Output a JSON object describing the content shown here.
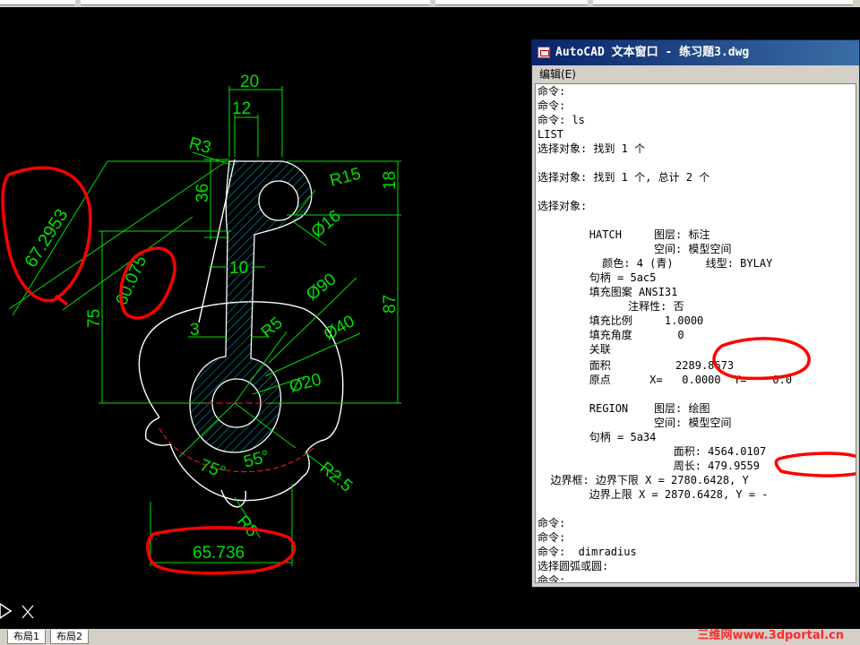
{
  "window": {
    "title": "AutoCAD 文本窗口 - 练习题3.dwg",
    "menu": "编辑(E)"
  },
  "drawing": {
    "dims": {
      "d20": "20",
      "d12": "12",
      "r3": "R3",
      "d36": "36",
      "r15": "R15",
      "d18": "18",
      "phi16": "Ø16",
      "d10": "10",
      "phi90": "Ø90",
      "d87": "87",
      "d75": "75",
      "d3": "3",
      "r5a": "R5",
      "phi40": "Ø40",
      "phi20": "Ø20",
      "a75": "75°",
      "a55": "55°",
      "r25": "R2.5",
      "r5b": "R5"
    },
    "annotations": {
      "a1": "67.2953",
      "a2": "60.075",
      "a3": "65.736"
    }
  },
  "text_lines": [
    "命令:",
    "命令:",
    "命令: ls",
    "LIST",
    "选择对象: 找到 1 个",
    "",
    "选择对象: 找到 1 个, 总计 2 个",
    "",
    "选择对象:",
    "",
    "        HATCH     图层: 标注",
    "                  空间: 模型空间",
    "          颜色: 4 (青)     线型: BYLAY",
    "        句柄 = 5ac5",
    "        填充图案 ANSI31",
    "              注释性: 否",
    "        填充比例     1.0000",
    "        填充角度       0",
    "        关联",
    "        面积          2289.8673",
    "        原点      X=   0.0000  Y=    0.0",
    "",
    "        REGION    图层: 绘图",
    "                  空间: 模型空间",
    "        句柄 = 5a34",
    "                     面积: 4564.0107",
    "                     周长: 479.9559",
    "  边界框: 边界下限 X = 2780.6428, Y",
    "        边界上限 X = 2870.6428, Y = -",
    "",
    "",
    "命令:",
    "命令:",
    "命令:  dimradius",
    "选择圆弧或圆:",
    "命令:"
  ],
  "tabs": [
    "布局1",
    "布局2"
  ],
  "watermark": "三维网www.3dportal.cn",
  "colors": {
    "dimension": "#00e000",
    "hatch": "#00b4d8",
    "geometry": "#ffffff",
    "annotation": "#ff0000",
    "titlebar": "#0a246a"
  }
}
